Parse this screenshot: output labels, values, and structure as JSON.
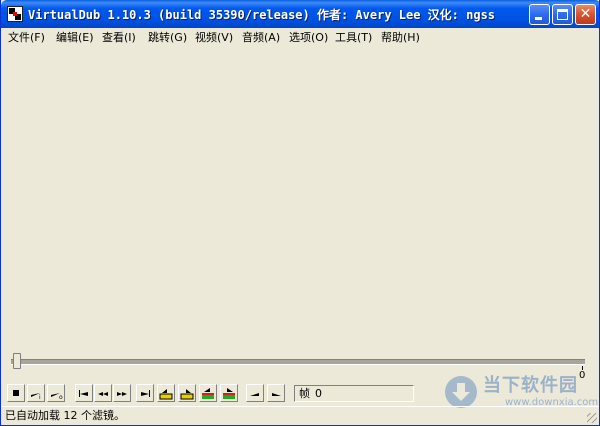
{
  "window": {
    "title": "VirtualDub 1.10.3 (build 35390/release) 作者: Avery Lee  汉化: ngss",
    "icon": "virtualdub-app-icon",
    "controls": {
      "minimize_icon": "minimize-icon",
      "maximize_icon": "maximize-icon",
      "close_icon": "close-icon",
      "close_glyph": "✕"
    }
  },
  "menu": {
    "items": [
      "文件(F)",
      "编辑(E)",
      "查看(I)",
      "跳转(G)",
      "视频(V)",
      "音频(A)",
      "选项(O)",
      "工具(T)",
      "帮助(H)"
    ]
  },
  "slider": {
    "position": 0,
    "end_label": "0"
  },
  "toolbar": {
    "buttons": [
      "stop-icon",
      "play-input-icon",
      "play-output-icon",
      "go-to-start-icon",
      "step-back-icon",
      "step-forward-icon",
      "go-to-end-icon",
      "previous-keyframe-icon",
      "next-keyframe-icon",
      "scene-back-icon",
      "scene-forward-icon",
      "mark-in-icon",
      "mark-out-icon"
    ],
    "frame_label": "帧",
    "frame_value": "0"
  },
  "watermark": {
    "brand": "当下软件园",
    "url": "www.downxia.com",
    "icon": "download-logo-icon"
  },
  "status": {
    "text": "已自动加载 12 个滤镜。"
  },
  "colors": {
    "title_bar": "#0054E3",
    "face": "#ECE9D8",
    "close_button": "#D8542E",
    "keyframe_yellow": "#E8D000",
    "scene_green": "#22AA22"
  }
}
